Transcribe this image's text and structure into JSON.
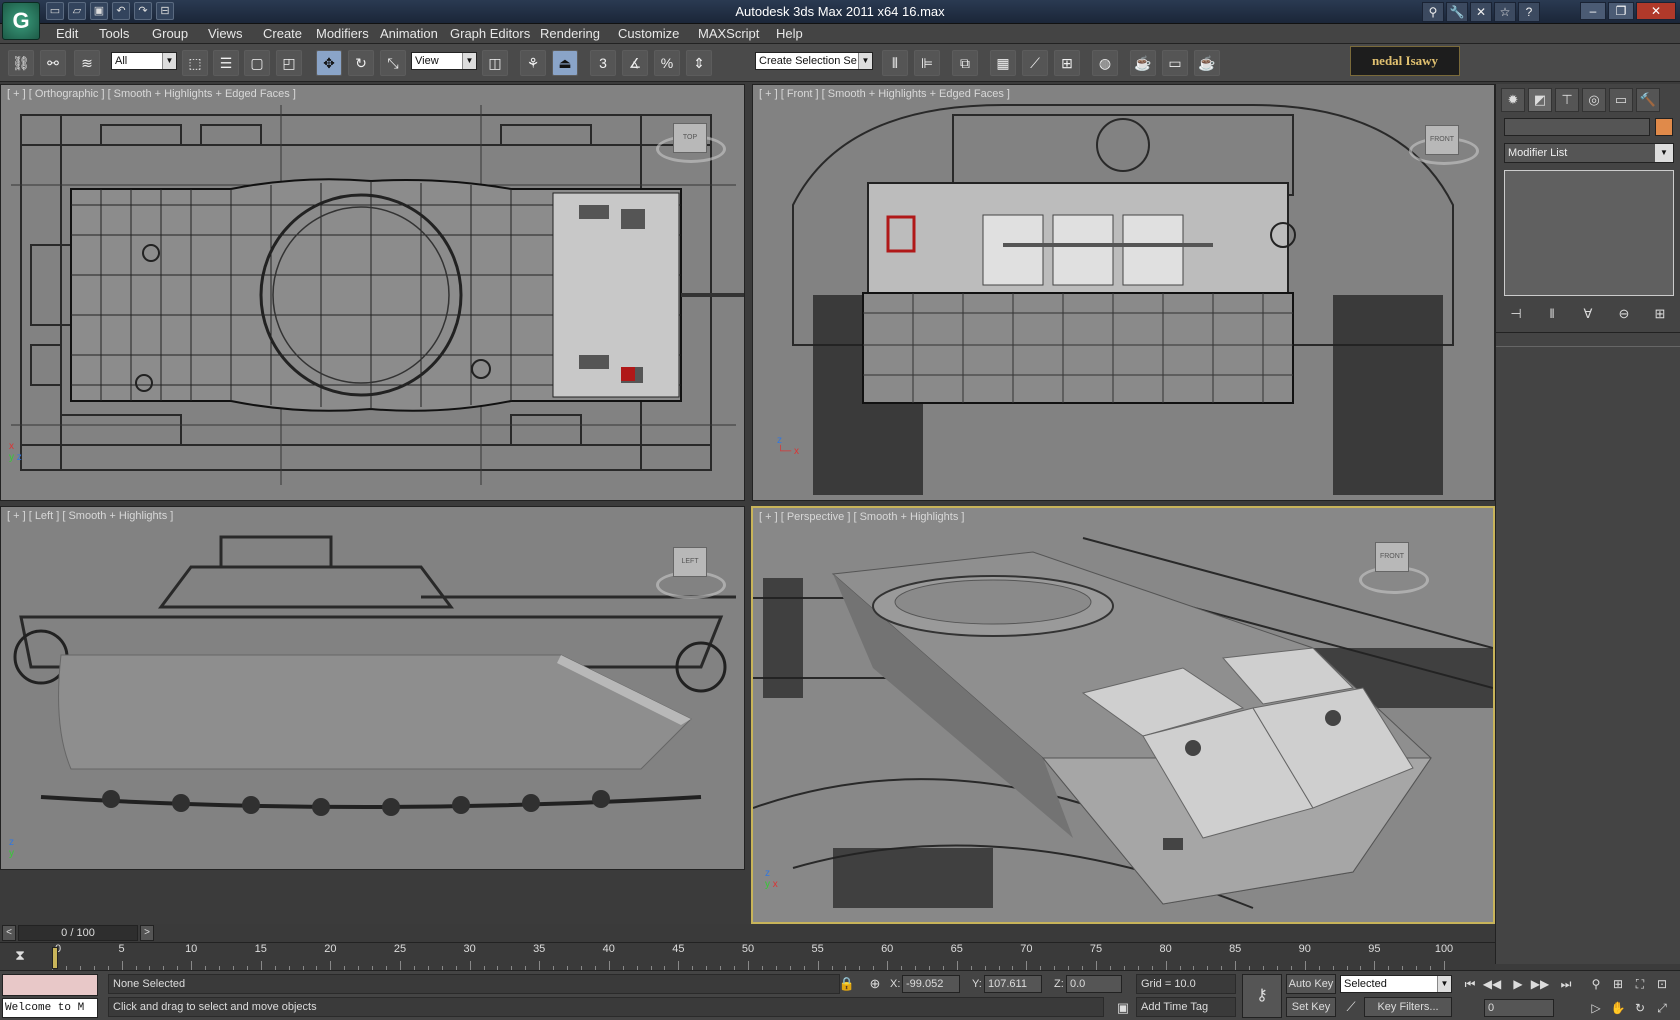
{
  "title": "Autodesk 3ds Max  2011 x64      16.max",
  "menu": [
    "Edit",
    "Tools",
    "Group",
    "Views",
    "Create",
    "Modifiers",
    "Animation",
    "Graph Editors",
    "Rendering",
    "Customize",
    "MAXScript",
    "Help"
  ],
  "toolbar": {
    "selection_filter": "All",
    "reference_coord": "View",
    "named_selection": "Create Selection Se",
    "signature": "nedal Isawy"
  },
  "viewports": {
    "top_left": "[ + ] [ Orthographic ] [ Smooth + Highlights + Edged Faces ]",
    "top_right": "[ + ] [ Front ] [ Smooth + Highlights + Edged Faces ]",
    "bottom_left": "[ + ] [ Left ] [ Smooth + Highlights ]",
    "bottom_right": "[ + ] [ Perspective ] [ Smooth + Highlights ]",
    "cube_front": "FRONT",
    "cube_left": "LEFT"
  },
  "command_panel": {
    "modifier_list": "Modifier List",
    "object_color": "#e08a4a"
  },
  "timeline": {
    "frame_display": "0 / 100",
    "ticks": [
      "0",
      "5",
      "10",
      "15",
      "20",
      "25",
      "30",
      "35",
      "40",
      "45",
      "50",
      "55",
      "60",
      "65",
      "70",
      "75",
      "80",
      "85",
      "90",
      "95",
      "100"
    ]
  },
  "status": {
    "listener_text": "Welcome to M",
    "selection": "None Selected",
    "prompt": "Click and drag to select and move objects",
    "x_label": "X:",
    "x_value": "-99.052",
    "y_label": "Y:",
    "y_value": "107.611",
    "z_label": "Z:",
    "z_value": "0.0",
    "grid": "Grid = 10.0",
    "add_time_tag": "Add Time Tag",
    "auto_key": "Auto Key",
    "set_key": "Set Key",
    "key_mode": "Selected",
    "key_filters": "Key Filters...",
    "current_frame": "0"
  }
}
